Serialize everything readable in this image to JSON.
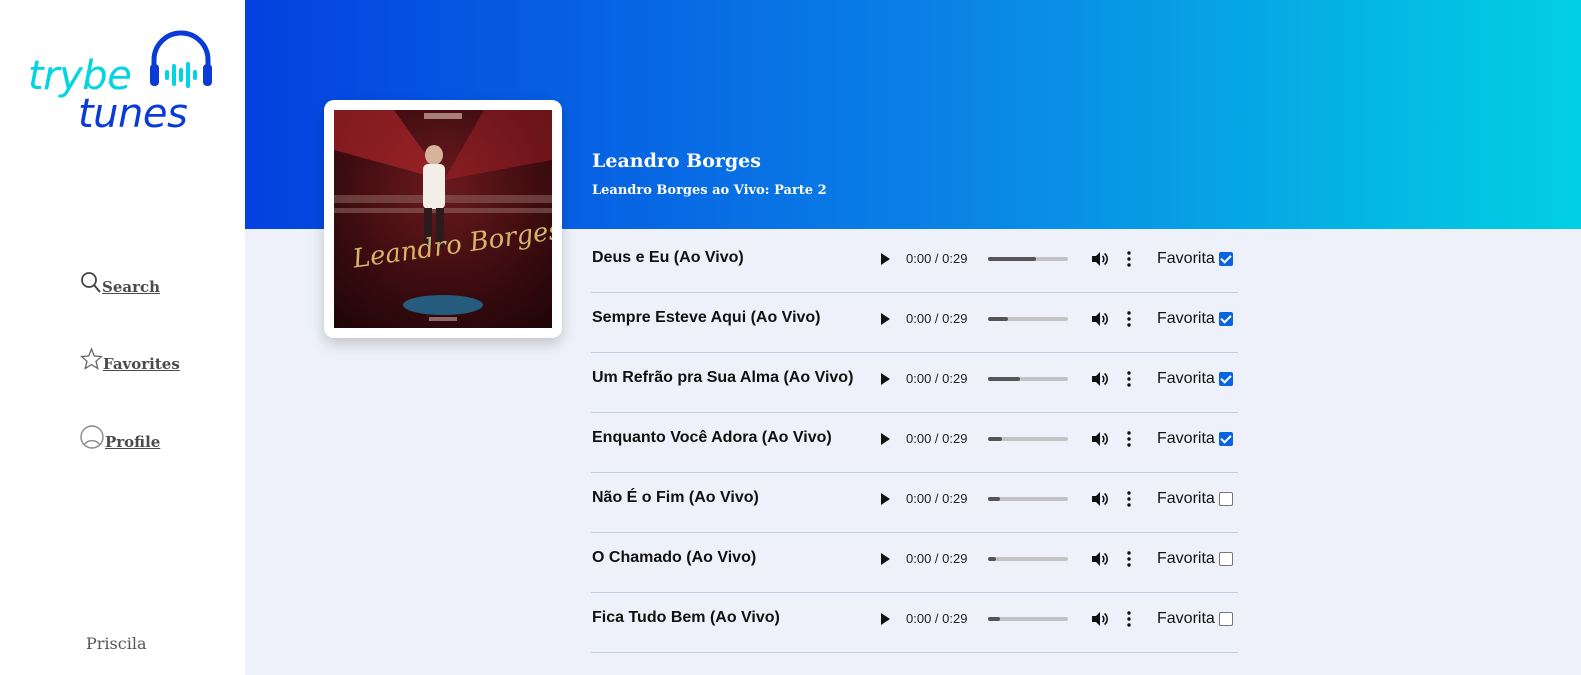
{
  "sidebar": {
    "logo": {
      "word1": "trybe",
      "word2": "tunes"
    },
    "nav": [
      {
        "label": "Search",
        "icon": "search-icon"
      },
      {
        "label": "Favorites",
        "icon": "star-icon"
      },
      {
        "label": "Profile",
        "icon": "user-icon"
      }
    ],
    "username": "Priscila"
  },
  "album": {
    "artist": "Leandro Borges",
    "title": "Leandro Borges ao Vivo: Parte 2",
    "cover_text": "Leandro Borges"
  },
  "favorite_label": "Favorita",
  "tracks": [
    {
      "name": "Deus e Eu (Ao Vivo)",
      "time": "0:00 / 0:29",
      "progress": 0.6,
      "favorite": true
    },
    {
      "name": "Sempre Esteve Aqui (Ao Vivo)",
      "time": "0:00 / 0:29",
      "progress": 0.25,
      "favorite": true
    },
    {
      "name": "Um Refrão pra Sua Alma (Ao Vivo)",
      "time": "0:00 / 0:29",
      "progress": 0.4,
      "favorite": true
    },
    {
      "name": "Enquanto Você Adora (Ao Vivo)",
      "time": "0:00 / 0:29",
      "progress": 0.18,
      "favorite": true
    },
    {
      "name": "Não É o Fim (Ao Vivo)",
      "time": "0:00 / 0:29",
      "progress": 0.15,
      "favorite": false
    },
    {
      "name": "O Chamado (Ao Vivo)",
      "time": "0:00 / 0:29",
      "progress": 0.1,
      "favorite": false
    },
    {
      "name": "Fica Tudo Bem (Ao Vivo)",
      "time": "0:00 / 0:29",
      "progress": 0.15,
      "favorite": false
    }
  ],
  "colors": {
    "brand_cyan": "#00d5e2",
    "brand_blue": "#0a3bd8",
    "checkbox": "#0a64e0"
  }
}
